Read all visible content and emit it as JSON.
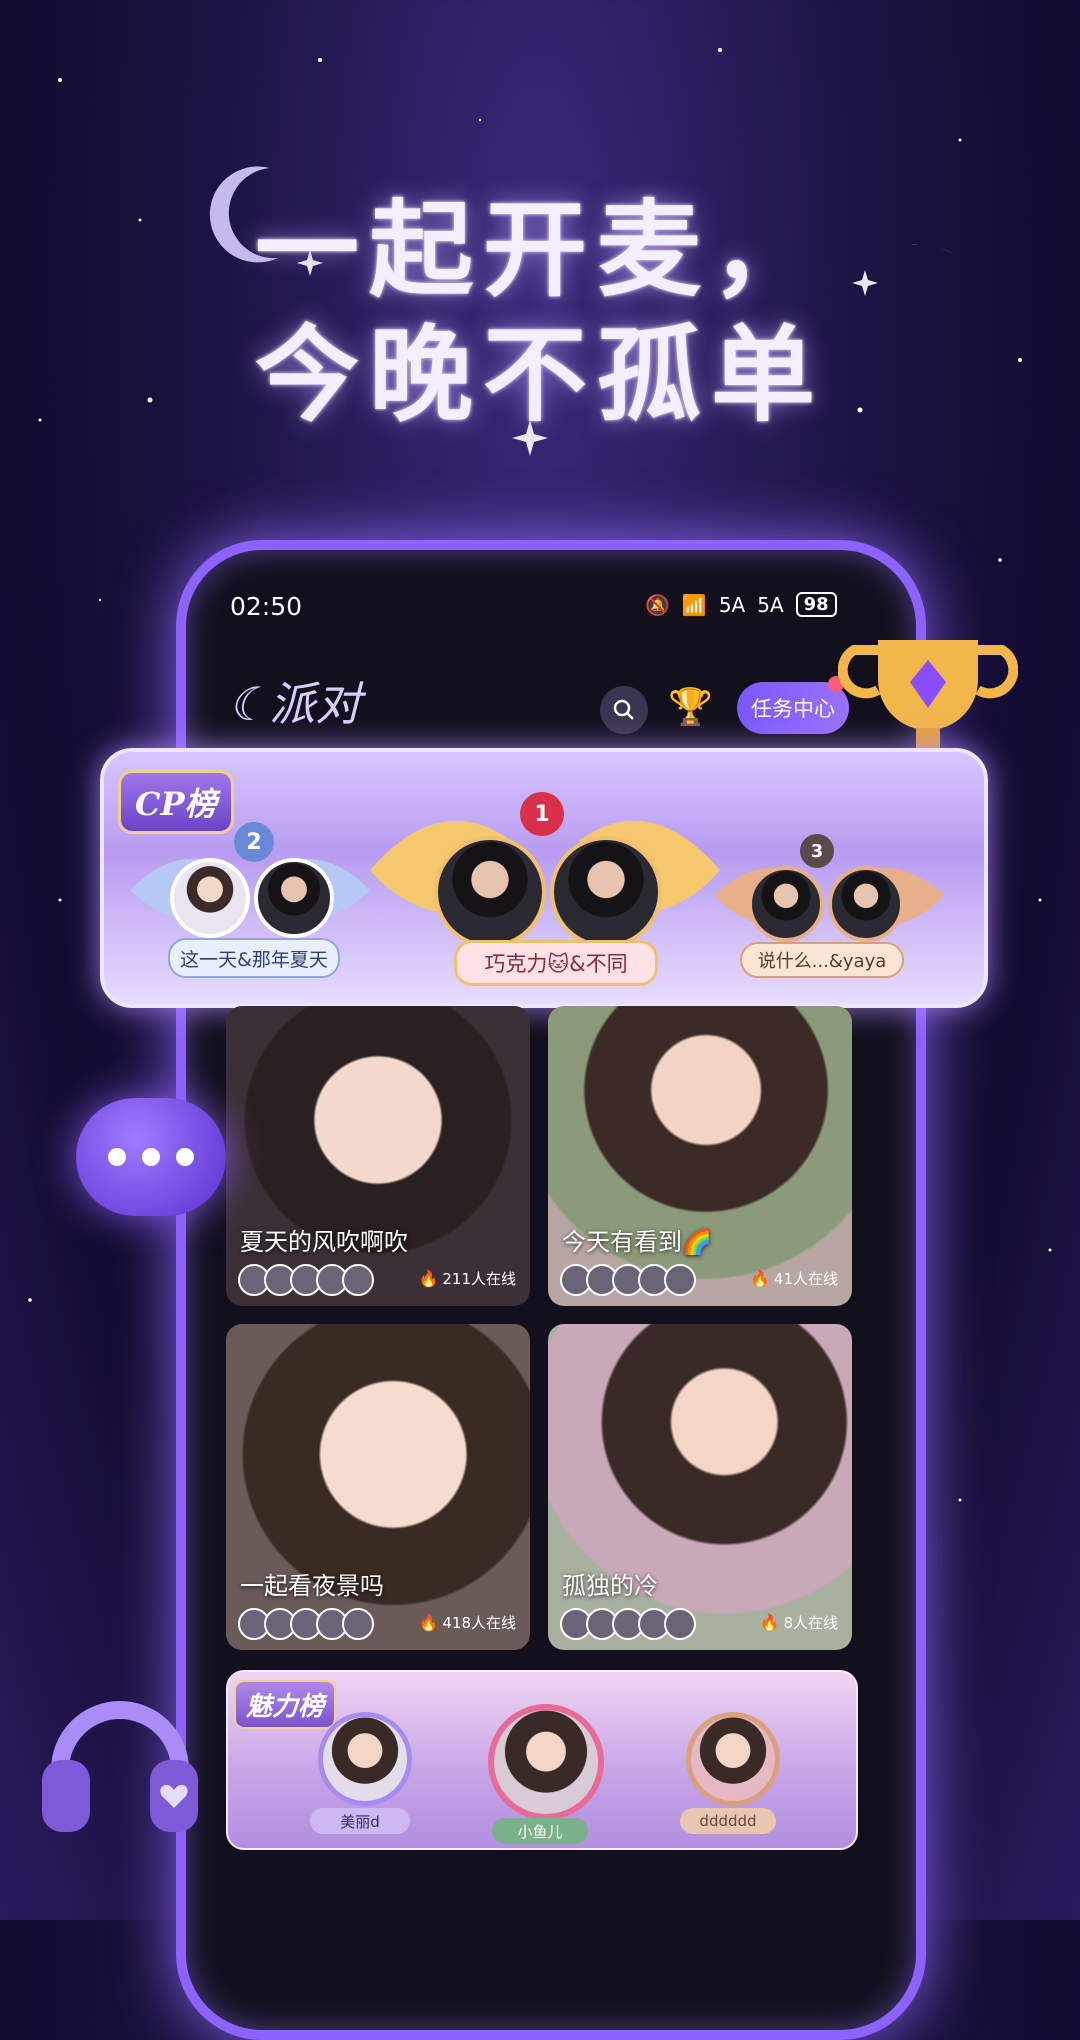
{
  "headline": {
    "line1": "一起开麦，",
    "line2": "今晚不孤单"
  },
  "status_bar": {
    "time": "02:50",
    "signal1": "5A",
    "signal2": "5A",
    "battery": "98"
  },
  "app": {
    "logo_text": "派对",
    "task_center_label": "任务中心",
    "icons": [
      "search-icon",
      "trophy-icon"
    ]
  },
  "cp_board": {
    "title": "CP榜",
    "pairs": [
      {
        "rank": "2",
        "name": "这一天&那年夏天"
      },
      {
        "rank": "1",
        "name": "巧克力🐱&不同"
      },
      {
        "rank": "3",
        "name": "说什么...&yaya"
      }
    ]
  },
  "rooms": [
    {
      "title": "夏天的风吹啊吹",
      "online": "211人在线"
    },
    {
      "title": "今天有看到🌈",
      "online": "41人在线"
    },
    {
      "title": "一起看夜景吗",
      "online": "418人在线"
    },
    {
      "title": "孤独的冷",
      "online": "8人在线"
    }
  ],
  "charm_board": {
    "title": "魅力榜",
    "entries": [
      {
        "name": "美丽d"
      },
      {
        "name": "小鱼儿"
      },
      {
        "name": "dddddd"
      }
    ]
  },
  "colors": {
    "accent": "#8d63ff",
    "background": "#1a1240",
    "fire": "#ff5a2a"
  }
}
